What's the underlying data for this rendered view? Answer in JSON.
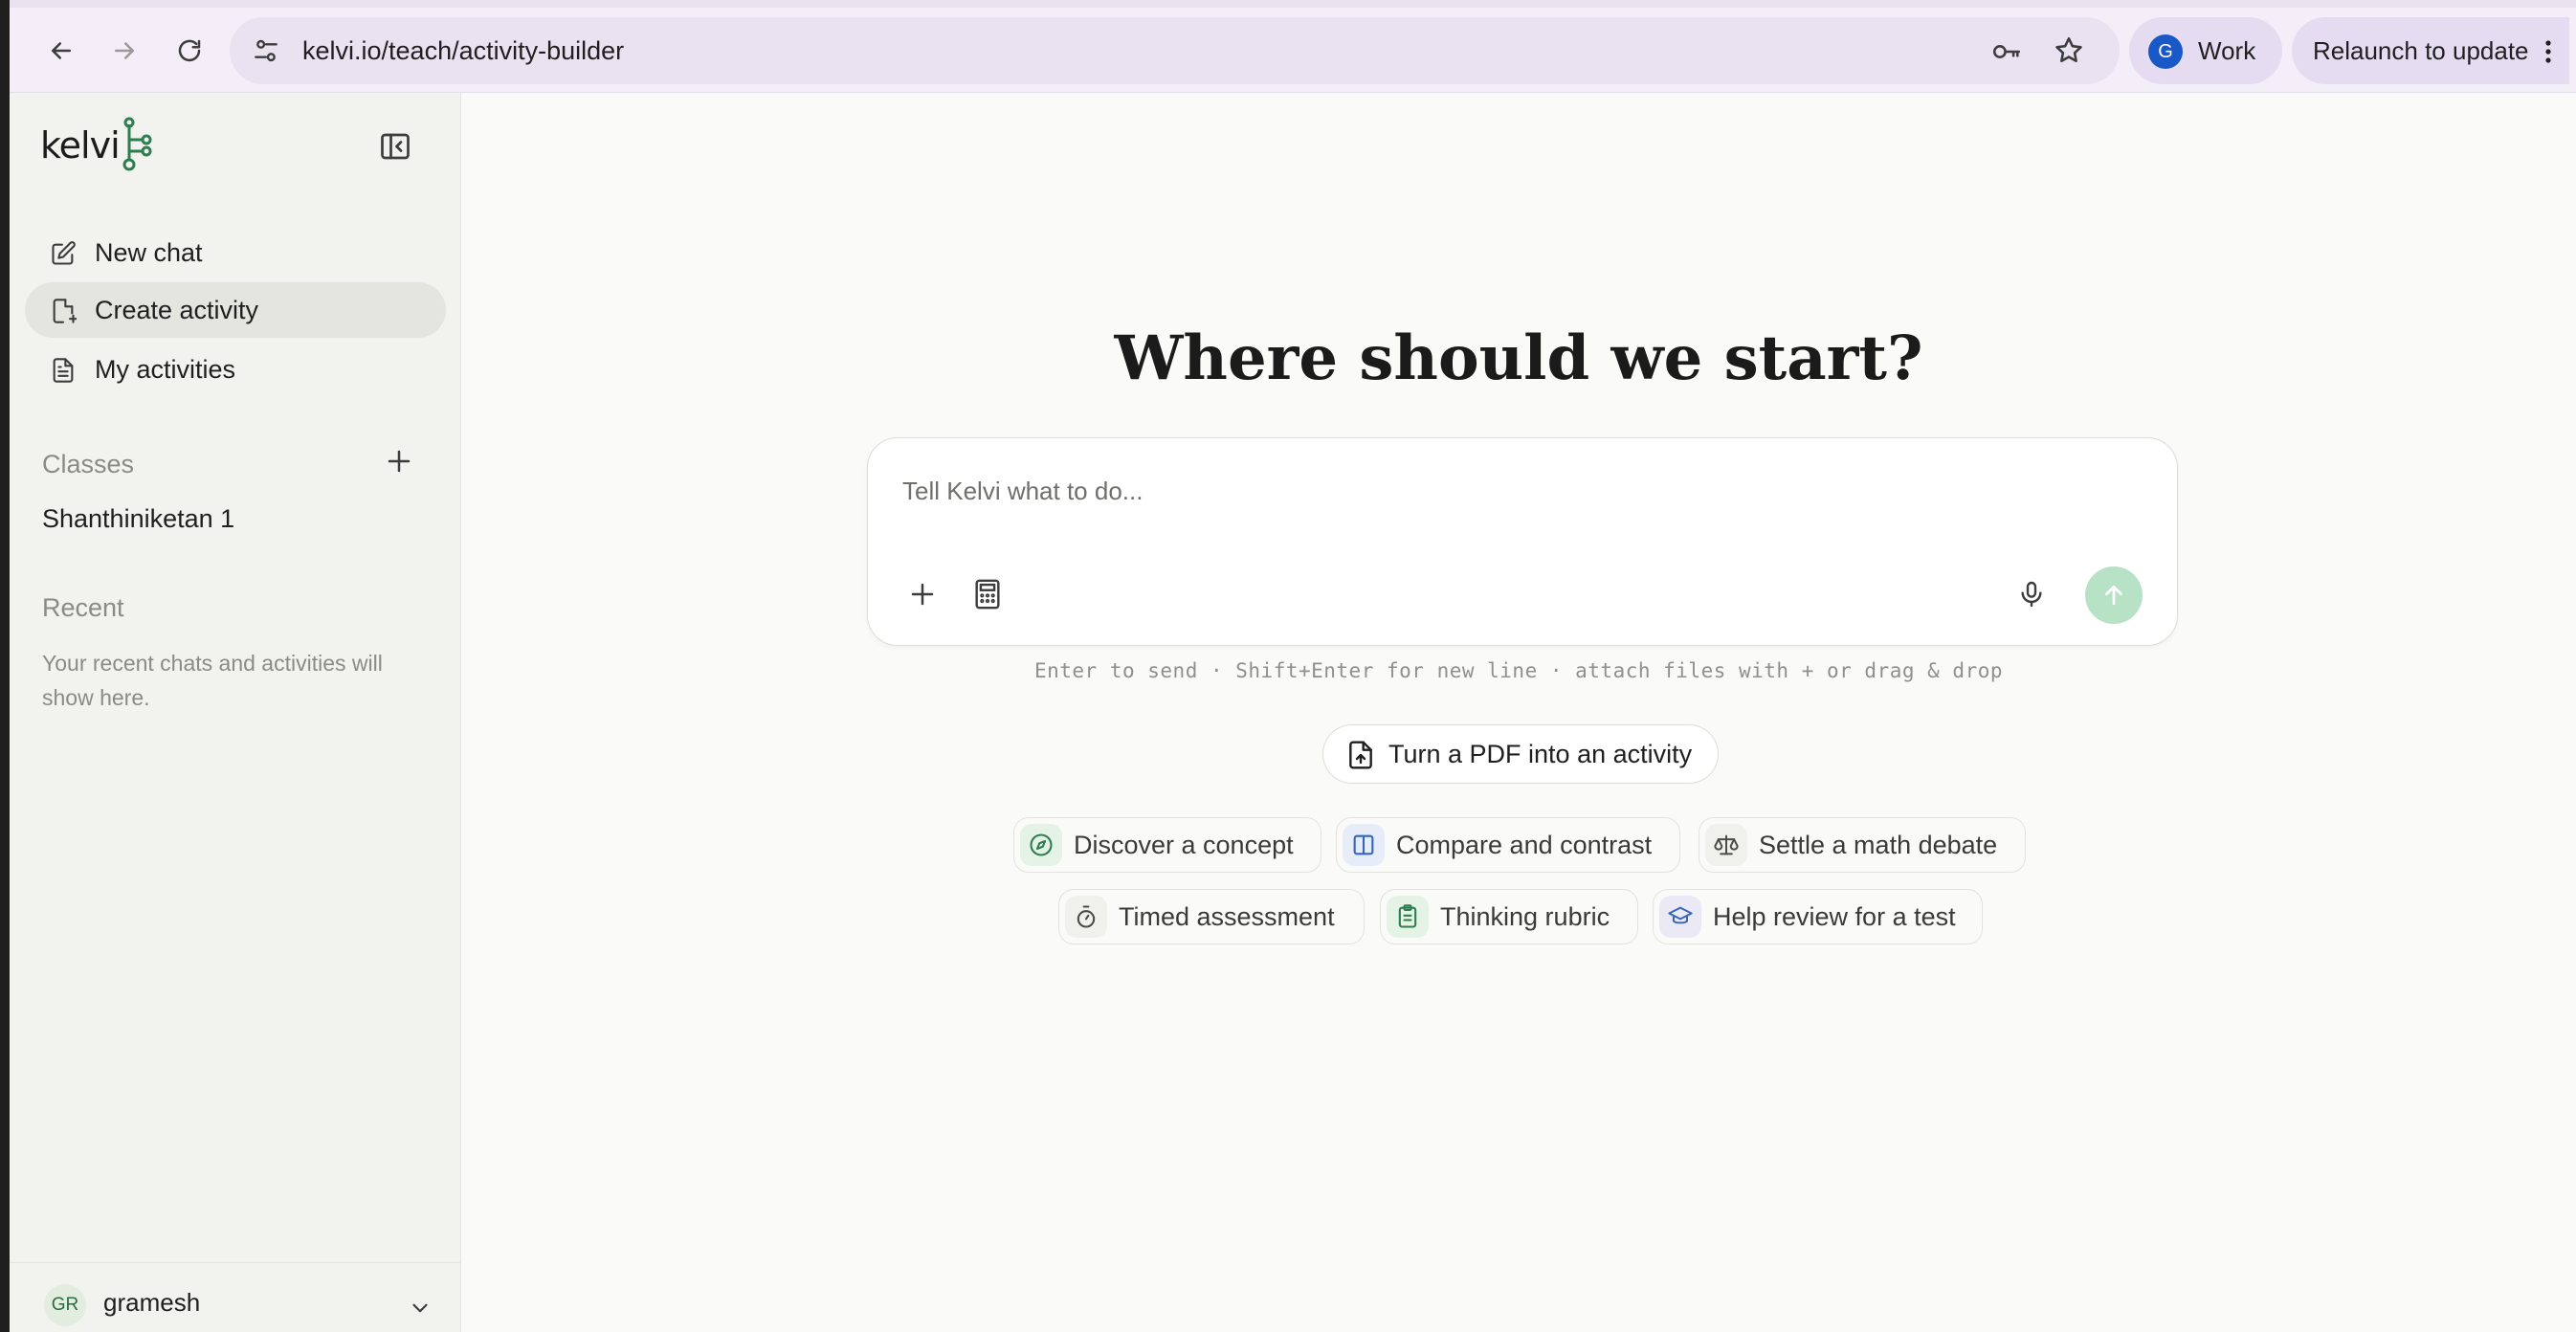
{
  "browser": {
    "url": "kelvi.io/teach/activity-builder",
    "profile_initial": "G",
    "profile_label": "Work",
    "relaunch_label": "Relaunch to update"
  },
  "sidebar": {
    "logo_text": "kelvi",
    "nav": [
      {
        "label": "New chat",
        "icon": "edit-icon"
      },
      {
        "label": "Create activity",
        "icon": "file-plus-icon",
        "active": true
      },
      {
        "label": "My activities",
        "icon": "document-icon"
      }
    ],
    "classes_label": "Classes",
    "classes": [
      "Shanthiniketan 1"
    ],
    "recent_label": "Recent",
    "recent_empty": "Your recent chats and activities will show here.",
    "user": {
      "initials": "GR",
      "name": "gramesh"
    }
  },
  "main": {
    "title": "Where should we start?",
    "composer": {
      "placeholder": "Tell Kelvi what to do..."
    },
    "hint": "Enter to send · Shift+Enter for new line · attach files with + or drag & drop",
    "pdf_button": "Turn a PDF into an activity",
    "suggestions": [
      {
        "label": "Discover a concept",
        "icon": "compass-icon"
      },
      {
        "label": "Compare and contrast",
        "icon": "columns-icon"
      },
      {
        "label": "Settle a math debate",
        "icon": "scale-icon"
      },
      {
        "label": "Timed assessment",
        "icon": "timer-icon"
      },
      {
        "label": "Thinking rubric",
        "icon": "clipboard-icon"
      },
      {
        "label": "Help review for a test",
        "icon": "graduation-cap-icon"
      }
    ]
  },
  "colors": {
    "accent_green": "#2e7d4f",
    "send_button": "#b7e2c6",
    "sidebar_bg": "#f2f2ef",
    "toolbar_bg": "#f3eef8"
  }
}
